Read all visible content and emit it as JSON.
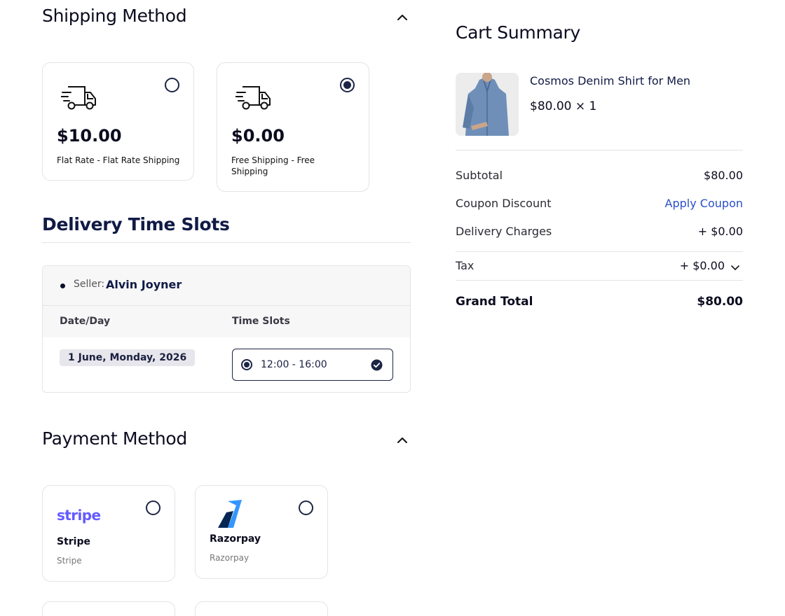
{
  "shipping": {
    "title": "Shipping Method",
    "options": [
      {
        "price": "$10.00",
        "label": "Flat Rate - Flat Rate Shipping",
        "selected": false
      },
      {
        "price": "$0.00",
        "label": "Free Shipping - Free Shipping",
        "selected": true
      }
    ]
  },
  "delivery": {
    "title": "Delivery Time Slots",
    "seller_prefix": "Seller:",
    "seller_name": "Alvin Joyner",
    "col_date": "Date/Day",
    "col_slots": "Time Slots",
    "date": "1 June, Monday, 2026",
    "slot": "12:00 - 16:00"
  },
  "payment": {
    "title": "Payment Method",
    "methods": [
      {
        "logo_text": "stripe",
        "name": "Stripe",
        "sub": "Stripe"
      },
      {
        "logo_text": "",
        "name": "Razorpay",
        "sub": "Razorpay"
      }
    ]
  },
  "cart": {
    "title": "Cart Summary",
    "item": {
      "name": "Cosmos Denim Shirt for Men",
      "price_qty": "$80.00 × 1"
    },
    "rows": {
      "subtotal_label": "Subtotal",
      "subtotal_value": "$80.00",
      "coupon_label": "Coupon Discount",
      "coupon_value": "Apply Coupon",
      "delivery_label": "Delivery Charges",
      "delivery_value": "+ $0.00",
      "tax_label": "Tax",
      "tax_value": "+ $0.00",
      "grand_label": "Grand Total",
      "grand_value": "$80.00"
    }
  },
  "colors": {
    "accent": "#1c2545",
    "link": "#2b4fc7",
    "border": "#e4e4e7",
    "stripe": "#635bff"
  }
}
